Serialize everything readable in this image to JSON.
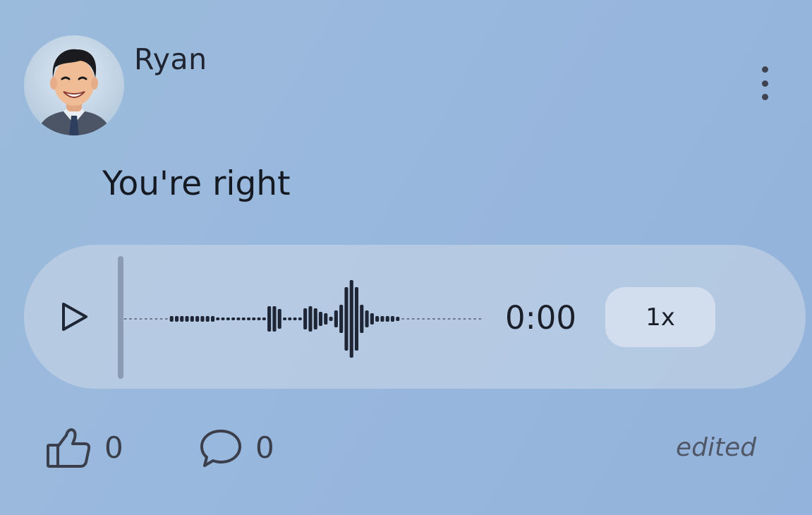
{
  "post": {
    "author": "Ryan",
    "message": "You're right",
    "edited_label": "edited"
  },
  "audio": {
    "time": "0:00",
    "speed": "1x",
    "progress": 0
  },
  "reactions": {
    "likes": "0",
    "comments": "0"
  },
  "icons": {
    "play": "play-icon",
    "more": "more-vertical-icon",
    "like": "thumbs-up-icon",
    "comment": "comment-bubble-icon"
  },
  "colors": {
    "background": "#98b7dd",
    "player_background": "#b4c7df",
    "waveform": "#1e2636",
    "scrubber": "#8b9bb3"
  }
}
